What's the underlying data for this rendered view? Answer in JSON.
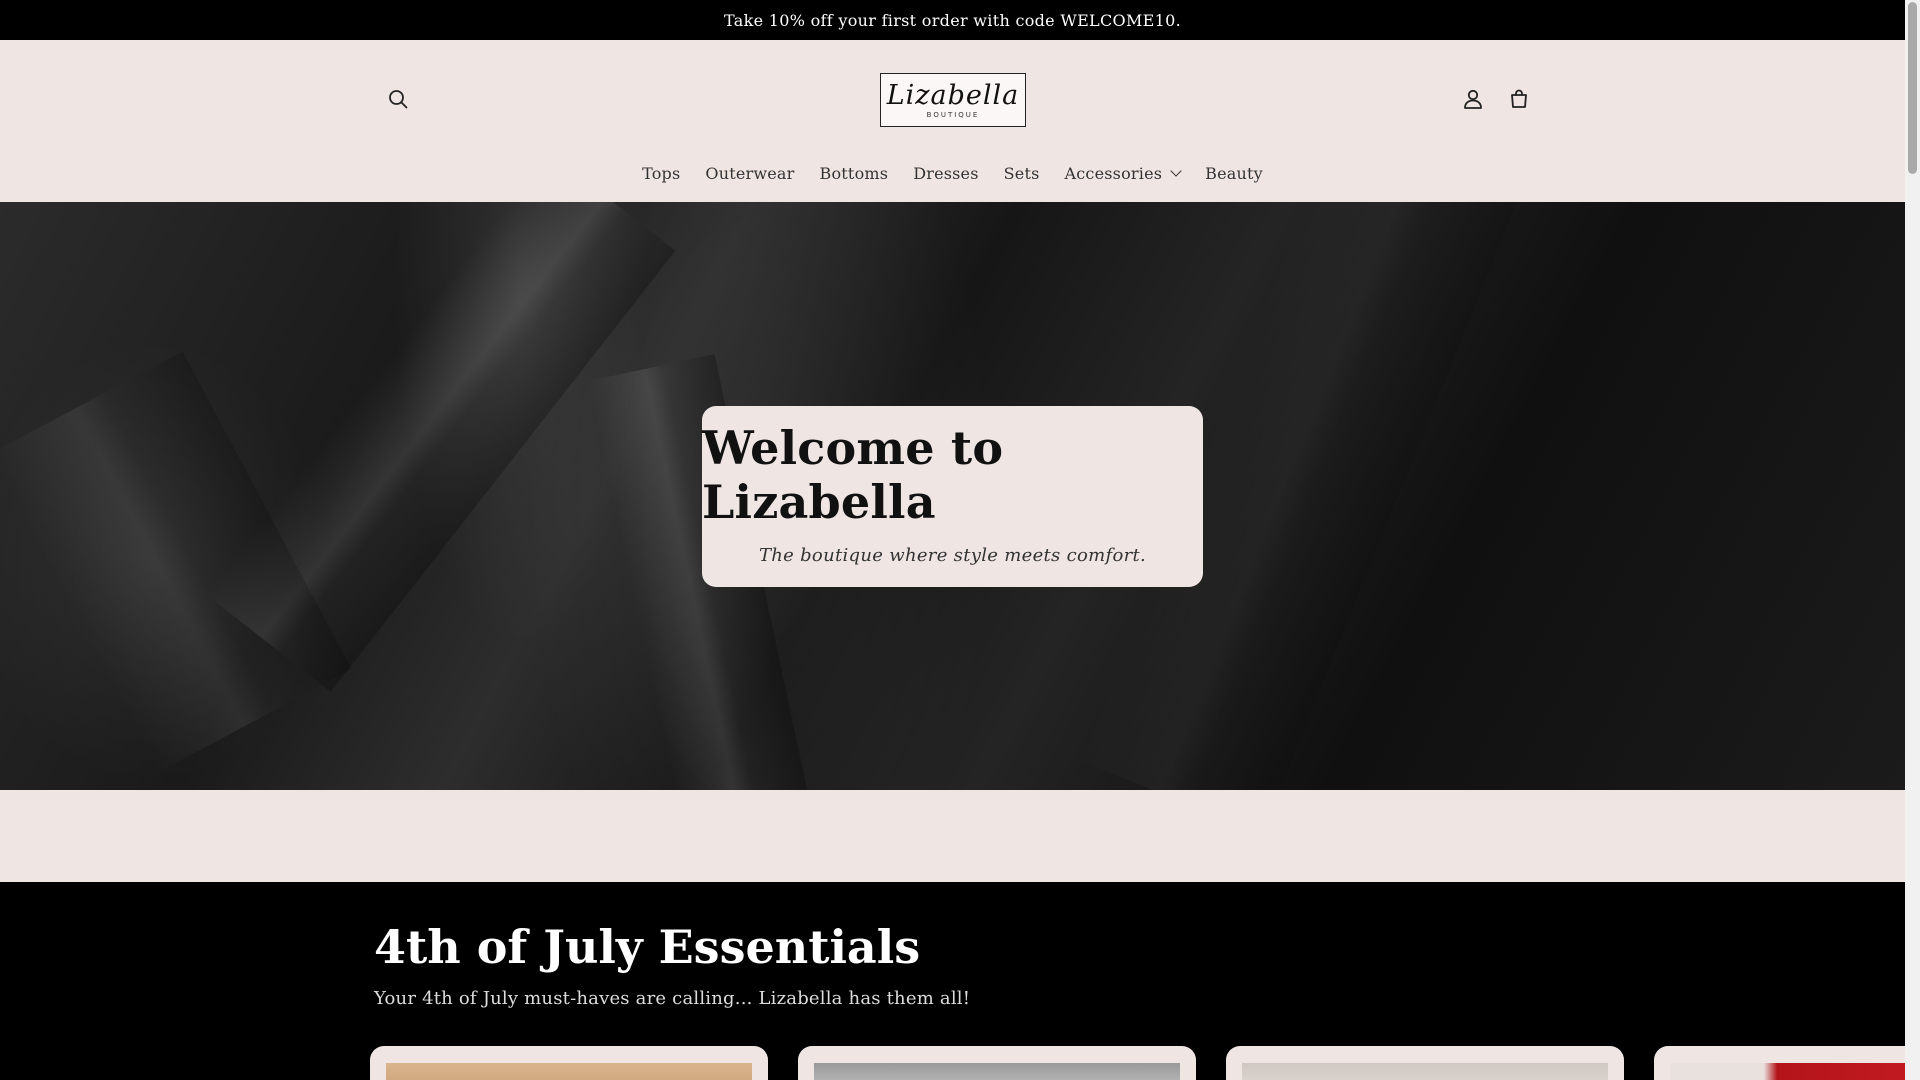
{
  "announcement": {
    "text": "Take 10% off your first order with code WELCOME10."
  },
  "header": {
    "logo": {
      "script": "Lizabella",
      "subtitle": "BOUTIQUE"
    },
    "icons": {
      "search": "search-icon",
      "account": "user-icon",
      "cart": "cart-icon"
    },
    "nav": [
      {
        "label": "Tops"
      },
      {
        "label": "Outerwear"
      },
      {
        "label": "Bottoms"
      },
      {
        "label": "Dresses"
      },
      {
        "label": "Sets"
      },
      {
        "label": "Accessories",
        "has_dropdown": true
      },
      {
        "label": "Beauty"
      }
    ]
  },
  "hero": {
    "title": "Welcome to Lizabella",
    "subtitle": "The boutique where style meets comfort."
  },
  "collection": {
    "title": "4th of July Essentials",
    "description": "Your 4th of July must-haves are calling... Lizabella has them all!",
    "product_count_visible": 4
  },
  "colors": {
    "background": "#efe6e4",
    "announcement_bg": "#000000",
    "text": "#222222",
    "collection_bg": "#000000"
  }
}
